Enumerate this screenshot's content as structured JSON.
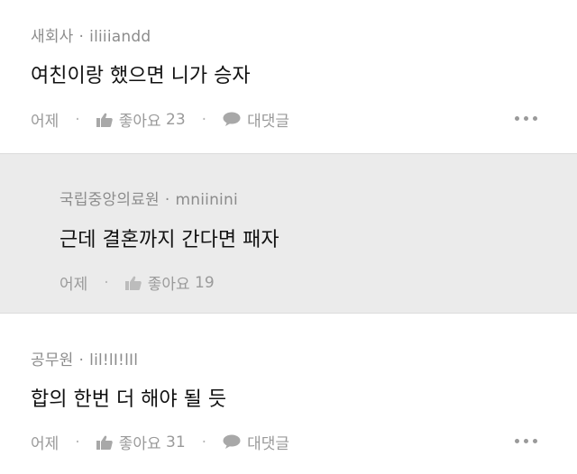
{
  "comments": [
    {
      "affiliation": "새회사",
      "separator": "·",
      "username": "iliiiandd",
      "text": "여친이랑 했으면 니가 승자",
      "date": "어제",
      "like_label": "좋아요",
      "likes": "23",
      "reply_label": "대댓글"
    },
    {
      "affiliation": "국립중앙의료원",
      "separator": "·",
      "username": "mniinini",
      "text": "근데 결혼까지 간다면 패자",
      "date": "어제",
      "like_label": "좋아요",
      "likes": "19"
    },
    {
      "affiliation": "공무원",
      "separator": "·",
      "username": "lil!lI!lIl",
      "text": "합의 한번 더 해야 될 듯",
      "date": "어제",
      "like_label": "좋아요",
      "likes": "31",
      "reply_label": "대댓글"
    }
  ],
  "icons": {
    "like": "thumbs-up-icon",
    "reply": "speech-bubble-icon",
    "more": "more-dots-icon"
  },
  "colors": {
    "reply_background": "#ebebeb",
    "meta_text": "#8c8c8c",
    "action_text": "#9a9a9a"
  }
}
